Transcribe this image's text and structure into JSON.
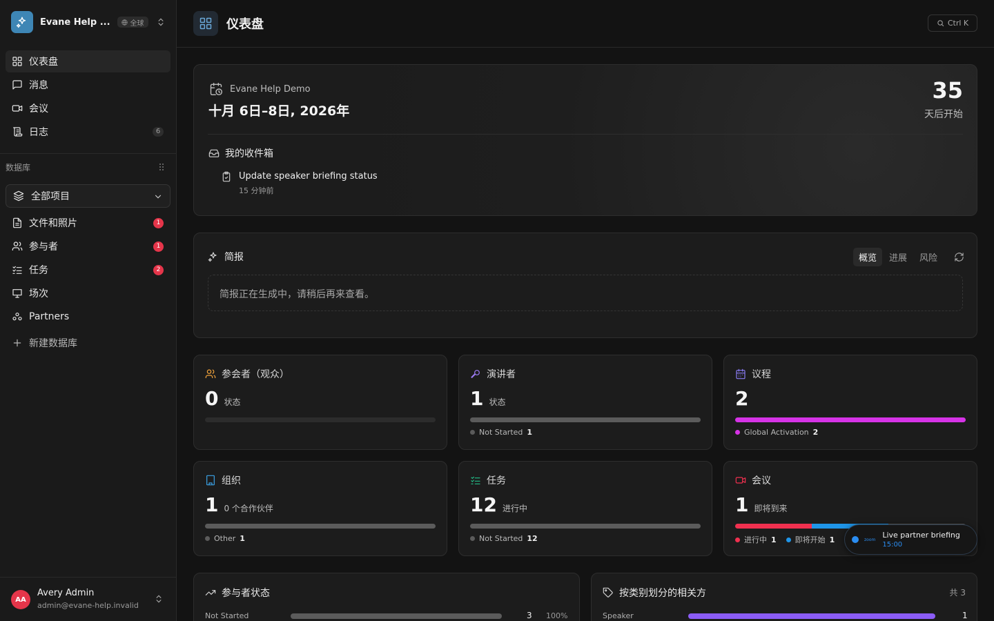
{
  "workspace": {
    "name": "Evane Help ...",
    "scope": "全球"
  },
  "nav": {
    "items": [
      {
        "label": "仪表盘"
      },
      {
        "label": "消息"
      },
      {
        "label": "会议"
      },
      {
        "label": "日志",
        "badge": "6"
      }
    ]
  },
  "database": {
    "section_label": "数据库",
    "selector": "全部项目",
    "items": [
      {
        "label": "文件和照片",
        "badge": "1"
      },
      {
        "label": "参与者",
        "badge": "1"
      },
      {
        "label": "任务",
        "badge": "2"
      },
      {
        "label": "场次"
      },
      {
        "label": "Partners"
      }
    ],
    "new_label": "新建数据库"
  },
  "user": {
    "initials": "AA",
    "name": "Avery Admin",
    "email": "admin@evane-help.invalid"
  },
  "header": {
    "title": "仪表盘",
    "search_shortcut": "Ctrl K"
  },
  "event": {
    "name": "Evane Help Demo",
    "dates": "十月 6日–8日, 2026年",
    "countdown_value": "35",
    "countdown_label": "天后开始",
    "inbox_title": "我的收件箱",
    "inbox_item": "Update speaker briefing status",
    "inbox_time": "15 分钟前"
  },
  "briefing": {
    "title": "简报",
    "tabs": [
      "概览",
      "进展",
      "风险"
    ],
    "placeholder": "简报正在生成中，请稍后再来查看。"
  },
  "stats": {
    "audience": {
      "title": "参会者（观众）",
      "value": "0",
      "sub": "状态"
    },
    "speakers": {
      "title": "演讲者",
      "value": "1",
      "sub": "状态",
      "legend": [
        {
          "label": "Not Started",
          "count": "1"
        }
      ]
    },
    "agenda": {
      "title": "议程",
      "value": "2",
      "legend": [
        {
          "label": "Global Activation",
          "count": "2"
        }
      ]
    },
    "orgs": {
      "title": "组织",
      "value": "1",
      "sub": "0 个合作伙伴",
      "legend": [
        {
          "label": "Other",
          "count": "1"
        }
      ]
    },
    "tasks": {
      "title": "任务",
      "value": "12",
      "sub": "进行中",
      "legend": [
        {
          "label": "Not Started",
          "count": "12"
        }
      ]
    },
    "meetings": {
      "title": "会议",
      "value": "1",
      "sub": "即将到来",
      "legend": [
        {
          "label": "进行中",
          "count": "1"
        },
        {
          "label": "即将开始",
          "count": "1"
        }
      ]
    }
  },
  "toast": {
    "title": "Live partner briefing",
    "time": "15:00",
    "brand": "zoom"
  },
  "participant_status": {
    "title": "参与者状态",
    "rows": [
      {
        "label": "Not Started",
        "value": "3",
        "pct": "100%"
      }
    ]
  },
  "stakeholders": {
    "title": "按类别划分的相关方",
    "total": "共 3",
    "rows": [
      {
        "label": "Speaker",
        "value": "1"
      }
    ]
  },
  "colors": {
    "accent_blue": "#2b8df1",
    "badge_red": "#e5354a",
    "magenta": "#d633e6",
    "purple": "#8b5cf6",
    "meeting_red": "#f0304f"
  }
}
